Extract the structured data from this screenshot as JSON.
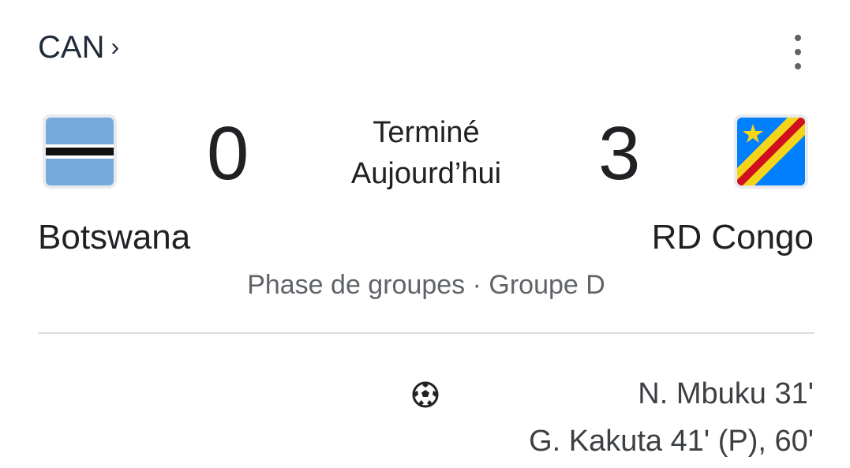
{
  "header": {
    "competition_label": "CAN",
    "chevron": "›",
    "more_icon": "more-vert-icon"
  },
  "match": {
    "status": "Terminé",
    "date": "Aujourd’hui",
    "phase": "Phase de groupes · Groupe D",
    "home": {
      "name": "Botswana",
      "score": "0",
      "flag_icon": "botswana-flag-icon"
    },
    "away": {
      "name": "RD Congo",
      "score": "3",
      "flag_icon": "dr-congo-flag-icon"
    }
  },
  "goals": {
    "icon": "soccer-ball-icon",
    "away_scorers": [
      "N. Mbuku 31'",
      "G. Kakuta 41' (P), 60'"
    ]
  },
  "colors": {
    "botswana_blue": "#75aadb",
    "congo_blue": "#007fff",
    "congo_red": "#ce1021",
    "congo_yellow": "#f7d618"
  }
}
